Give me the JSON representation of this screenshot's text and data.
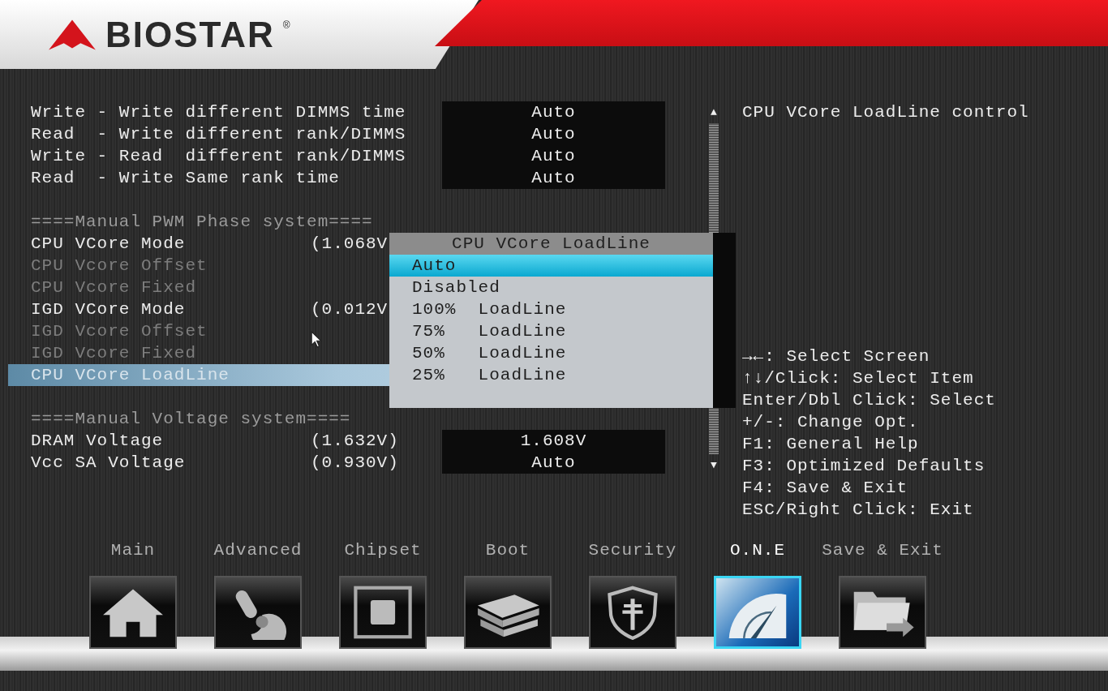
{
  "header": {
    "logo_text": "BIOSTAR",
    "logo_mark": "®"
  },
  "settings_groups": [
    {
      "rows": [
        {
          "label": "Write - Write different DIMMS time",
          "value": "Auto",
          "disabled": false,
          "selected": false
        },
        {
          "label": "Read  - Write different rank/DIMMS",
          "value": "Auto",
          "disabled": false,
          "selected": false
        },
        {
          "label": "Write - Read  different rank/DIMMS",
          "value": "Auto",
          "disabled": false,
          "selected": false
        },
        {
          "label": "Read  - Write Same rank time",
          "value": "Auto",
          "disabled": false,
          "selected": false
        }
      ]
    },
    {
      "title": "====Manual PWM Phase system====",
      "rows": [
        {
          "label": "CPU VCore Mode",
          "reading": "(1.068V",
          "disabled": false,
          "selected": false
        },
        {
          "label": "CPU Vcore Offset",
          "disabled": true,
          "selected": false
        },
        {
          "label": "CPU Vcore Fixed",
          "disabled": true,
          "selected": false
        },
        {
          "label": "IGD VCore Mode",
          "reading": "(0.012V",
          "disabled": false,
          "selected": false
        },
        {
          "label": "IGD Vcore Offset",
          "disabled": true,
          "selected": false
        },
        {
          "label": "IGD Vcore Fixed",
          "disabled": true,
          "selected": false
        },
        {
          "label": "CPU VCore LoadLine",
          "disabled": false,
          "selected": true
        }
      ]
    },
    {
      "title": "====Manual Voltage system====",
      "rows": [
        {
          "label": "DRAM Voltage",
          "reading": "(1.632V)",
          "value": "1.608V",
          "disabled": false,
          "selected": false
        },
        {
          "label": "Vcc SA Voltage",
          "reading": "(0.930V)",
          "value": "Auto",
          "disabled": false,
          "selected": false
        }
      ]
    }
  ],
  "scrollbar": {
    "up": "▲",
    "down": "▼"
  },
  "popup": {
    "title": "CPU VCore LoadLine",
    "options": [
      {
        "label": "Auto",
        "selected": true
      },
      {
        "label": "Disabled",
        "selected": false
      },
      {
        "label": "100%  LoadLine",
        "selected": false
      },
      {
        "label": "75%   LoadLine",
        "selected": false
      },
      {
        "label": "50%   LoadLine",
        "selected": false
      },
      {
        "label": "25%   LoadLine",
        "selected": false
      }
    ]
  },
  "help": {
    "description": "CPU VCore LoadLine control",
    "keys": [
      "→←: Select Screen",
      "↑↓/Click: Select Item",
      "Enter/Dbl Click: Select",
      "+/-: Change Opt.",
      "F1: General Help",
      "F3: Optimized Defaults",
      "F4: Save & Exit",
      "ESC/Right Click: Exit"
    ]
  },
  "tabs": [
    {
      "label": "Main",
      "selected": false
    },
    {
      "label": "Advanced",
      "selected": false
    },
    {
      "label": "Chipset",
      "selected": false
    },
    {
      "label": "Boot",
      "selected": false
    },
    {
      "label": "Security",
      "selected": false
    },
    {
      "label": "O.N.E",
      "selected": true
    },
    {
      "label": "Save & Exit",
      "selected": false
    }
  ]
}
